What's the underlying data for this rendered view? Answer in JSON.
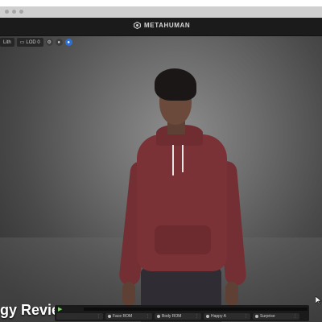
{
  "app": {
    "brand": "METAHUMAN"
  },
  "viewport_toolbar": {
    "lighting_label": "Lith",
    "lod_label": "LOD 0"
  },
  "overlay": {
    "caption": "gy Review"
  },
  "timeline": {
    "animations": [
      {
        "label": ""
      },
      {
        "label": "Face ROM"
      },
      {
        "label": "Body ROM"
      },
      {
        "label": "Happy A"
      },
      {
        "label": "Surprise"
      }
    ]
  }
}
